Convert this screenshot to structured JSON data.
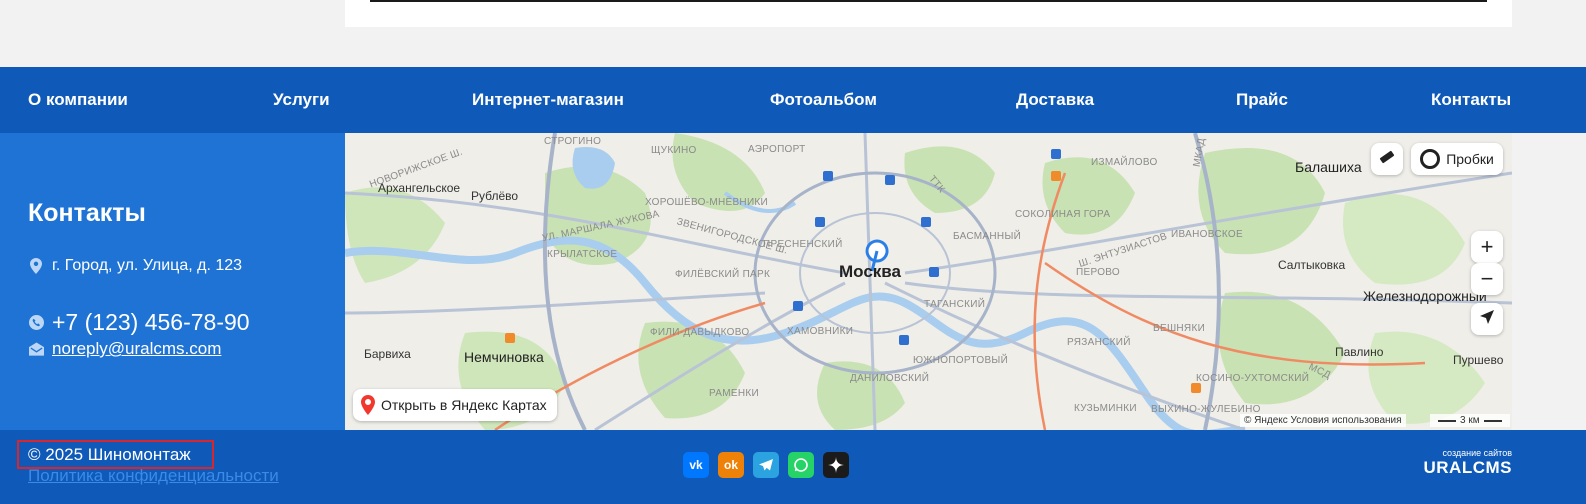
{
  "nav": {
    "items": [
      {
        "label": "О компании"
      },
      {
        "label": "Услуги"
      },
      {
        "label": "Интернет-магазин"
      },
      {
        "label": "Фотоальбом"
      },
      {
        "label": "Доставка"
      },
      {
        "label": "Прайс"
      },
      {
        "label": "Контакты"
      }
    ]
  },
  "contacts": {
    "title": "Контакты",
    "address": "г. Город, ул. Улица, д. 123",
    "phone": "+7 (123) 456-78-90",
    "email": "noreply@uralcms.com"
  },
  "map": {
    "center_city": "Москва",
    "traffic_label": "Пробки",
    "open_label": "Открыть в Яндекс Картах",
    "copyright": "© Яндекс  Условия использования",
    "scale_label": "3 км",
    "labels": {
      "l1": "Балашиха",
      "l2": "Архангельское",
      "l3": "Рублёво",
      "l4": "Салтыковка",
      "l5": "Железнодорожный",
      "l6": "Барвиха",
      "l7": "Немчиновка",
      "l8": "Павлино",
      "l9": "Пуршево",
      "d1": "СТРОГИНО",
      "d2": "ЩУКИНО",
      "d3": "АЭРОПОРТ",
      "d4": "ХОРОШЁВО-МНЁВНИКИ",
      "d5": "ИЗМАЙЛОВО",
      "d6": "ПРЕСНЕНСКИЙ",
      "d7": "БАСМАННЫЙ",
      "d8": "СОКОЛИНАЯ ГОРА",
      "d9": "ИВАНОВСКОЕ",
      "d10": "КРЫЛАТСКОЕ",
      "d11": "ФИЛЁВСКИЙ ПАРК",
      "d12": "ТАГАНСКИЙ",
      "d13": "ПЕРОВО",
      "d14": "ХАМОВНИКИ",
      "d15": "ФИЛИ-ДАВЫДКОВО",
      "d16": "ЮЖНОПОРТОВЫЙ",
      "d17": "ВЕШНЯКИ",
      "d18": "РЯЗАНСКИЙ",
      "d19": "ДАНИЛОВСКИЙ",
      "d20": "РАМЕНКИ",
      "d21": "КОСИНО-УХТОМСКИЙ",
      "d22": "КУЗЬМИНКИ",
      "d23": "ВЫХИНО-ЖУЛЕБИНО",
      "r1": "НОВОРИЖСКОЕ Ш.",
      "r2": "ЗВЕНИГОРОДСКОЕ Ш.",
      "r3": "УЛ. МАРШАЛА ЖУКОВА",
      "r4": "Ш. ЭНТУЗИАСТОВ",
      "r5": "МКАД",
      "r6": "ТТК",
      "r7": "МСД"
    }
  },
  "footer": {
    "copyright": "© 2025 Шиномонтаж",
    "policy": "Политика конфиденциальности",
    "dev_small": "создание сайтов",
    "dev_brand": "URALCMS"
  },
  "socials": [
    {
      "name": "vk",
      "label": "vk",
      "color": "#0077ff"
    },
    {
      "name": "odnoklassniki",
      "label": "ok",
      "color": "#ee8208"
    },
    {
      "name": "telegram",
      "label": "",
      "color": "#2aa3e0"
    },
    {
      "name": "whatsapp",
      "label": "",
      "color": "#25d366"
    },
    {
      "name": "dzen",
      "label": "",
      "color": "#1b1b1b"
    }
  ],
  "colors": {
    "nav_bg": "#0f5ab8",
    "contacts_bg": "#1e73d4",
    "highlight_border": "#d9262d"
  }
}
